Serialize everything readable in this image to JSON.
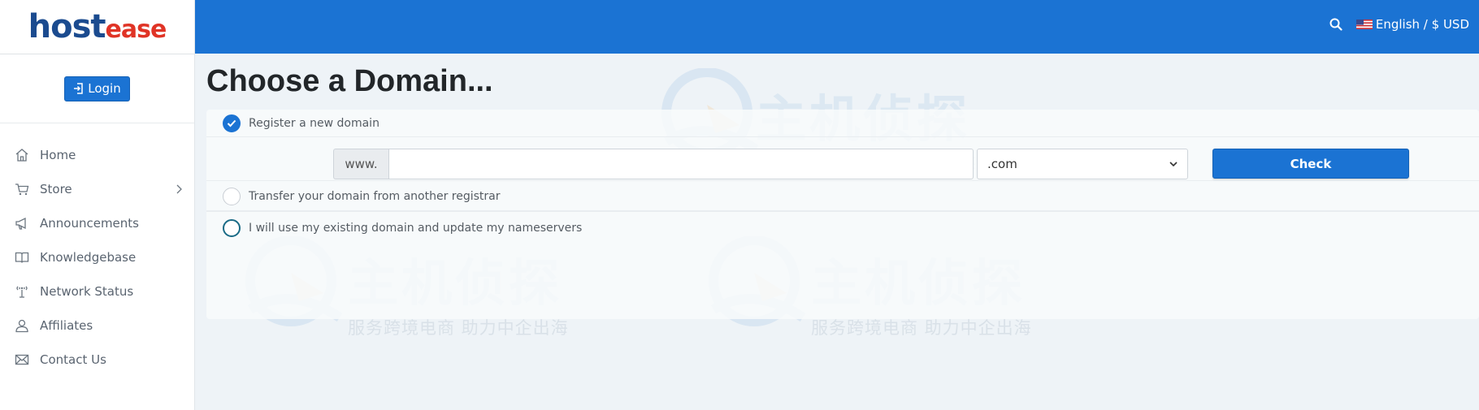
{
  "brand": {
    "logo_host": "host",
    "logo_ease": "ease"
  },
  "sidebar": {
    "login_label": "Login",
    "items": [
      {
        "label": "Home",
        "icon": "home-icon"
      },
      {
        "label": "Store",
        "icon": "cart-icon",
        "has_submenu": true
      },
      {
        "label": "Announcements",
        "icon": "megaphone-icon"
      },
      {
        "label": "Knowledgebase",
        "icon": "book-icon"
      },
      {
        "label": "Network Status",
        "icon": "antenna-icon"
      },
      {
        "label": "Affiliates",
        "icon": "user-icon"
      },
      {
        "label": "Contact Us",
        "icon": "envelope-icon"
      }
    ]
  },
  "header": {
    "language_currency": "English / $ USD",
    "flag": "us-flag-icon",
    "search_icon": "search-icon"
  },
  "main": {
    "title": "Choose a Domain...",
    "options": [
      {
        "label": "Register a new domain",
        "checked": true
      },
      {
        "label": "Transfer your domain from another registrar",
        "checked": false
      },
      {
        "label": "I will use my existing domain and update my nameservers",
        "checked": false
      }
    ],
    "domain_prefix": "www.",
    "domain_value": "",
    "tld_selected": ".com",
    "check_label": "Check"
  },
  "watermark": {
    "big": "主机侦探",
    "small": "服务跨境电商  助力中企出海"
  },
  "colors": {
    "primary": "#1b73d3",
    "logo_blue": "#1b4b8f",
    "logo_red": "#e03426",
    "sidebar_text": "#5a6470",
    "title": "#222629"
  }
}
